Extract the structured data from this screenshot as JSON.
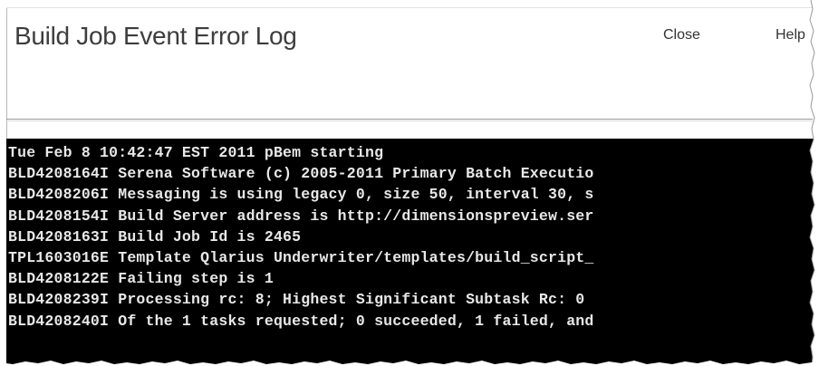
{
  "dialog": {
    "title": "Build Job Event Error Log",
    "close_label": "Close",
    "help_label": "Help"
  },
  "log": {
    "lines": [
      "Tue Feb 8 10:42:47 EST 2011 pBem starting",
      "BLD4208164I Serena Software (c) 2005-2011 Primary Batch Executio",
      "BLD4208206I Messaging is using legacy 0, size 50, interval 30, s",
      "BLD4208154I Build Server address is http://dimensionspreview.ser",
      "BLD4208163I Build Job Id is 2465",
      "TPL1603016E Template Qlarius Underwriter/templates/build_script_",
      "BLD4208122E Failing step is 1",
      "BLD4208239I Processing rc: 8; Highest Significant Subtask Rc: 0",
      "BLD4208240I Of the 1 tasks requested; 0 succeeded, 1 failed, and"
    ]
  },
  "colors": {
    "console_background": "#000000",
    "console_text": "#e8e8e8",
    "title_text": "#3d3d3d"
  }
}
